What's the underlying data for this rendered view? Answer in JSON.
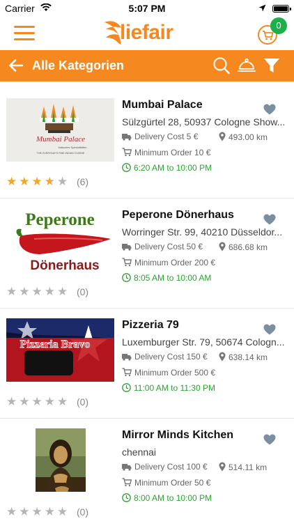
{
  "status_bar": {
    "carrier": "Carrier",
    "time": "5:07 PM"
  },
  "app_bar": {
    "logo_text": "liefair",
    "cart_count": "0"
  },
  "category_bar": {
    "title": "Alle Kategorien"
  },
  "colors": {
    "accent": "#f5891f",
    "badge": "#1bb04a",
    "hours": "#2aa52f",
    "star": "#f5a623"
  },
  "restaurants": [
    {
      "name": "Mumbai Palace",
      "address": "Sülzgürtel 28, 50937 Cologne Show...",
      "delivery": "Delivery Cost 5 €",
      "distance": "493.00 km",
      "min_order": "Minimum Order 10 €",
      "hours": "6:20 AM to 10:00 PM",
      "rating": 3.5,
      "rating_count": "(6)"
    },
    {
      "name": "Peperone Dönerhaus",
      "address": "Worringer Str. 99, 40210 Düsseldor...",
      "delivery": "Delivery Cost 50 €",
      "distance": "686.68 km",
      "min_order": "Minimum Order 200 €",
      "hours": "8:05 AM to 10:00 AM",
      "rating": 0,
      "rating_count": "(0)"
    },
    {
      "name": "Pizzeria 79",
      "address": "Luxemburger Str. 79, 50674 Cologn...",
      "delivery": "Delivery Cost 150 €",
      "distance": "638.14 km",
      "min_order": "Minimum Order 500 €",
      "hours": "11:00 AM to 11:30 PM",
      "rating": 0,
      "rating_count": "(0)"
    },
    {
      "name": "Mirror Minds Kitchen",
      "address": "chennai",
      "delivery": "Delivery Cost 100 €",
      "distance": "514.11 km",
      "min_order": "Minimum Order 50 €",
      "hours": "8:00 AM to 10:00 PM",
      "rating": 0,
      "rating_count": "(0)"
    }
  ],
  "thumbnails": {
    "mumbai": {
      "title": "Mumbai Palace",
      "subtitle": "Indisches Spezialitäten",
      "tagline": "THE EVERYDAY'S FINE INDIAN CUISINE"
    },
    "peperone": {
      "line1": "Peperone",
      "line2": "Dönerhaus"
    },
    "pizzeria": {
      "text": "Pizzeria Bravo"
    }
  }
}
